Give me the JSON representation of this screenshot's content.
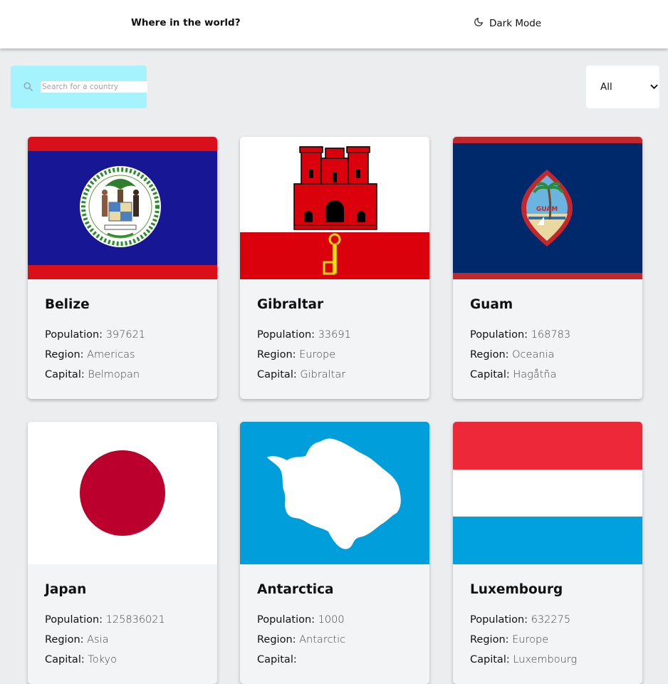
{
  "header": {
    "title": "Where in the world?",
    "dark_mode_label": "Dark Mode"
  },
  "search": {
    "placeholder": "Search for a country",
    "value": ""
  },
  "filter": {
    "selected": "All"
  },
  "labels": {
    "population": "Population:",
    "region": "Region:",
    "capital": "Capital:"
  },
  "countries": [
    {
      "name": "Belize",
      "population": "397621",
      "region": "Americas",
      "capital": "Belmopan",
      "flag": "belize-flag"
    },
    {
      "name": "Gibraltar",
      "population": "33691",
      "region": "Europe",
      "capital": "Gibraltar",
      "flag": "gibraltar-flag"
    },
    {
      "name": "Guam",
      "population": "168783",
      "region": "Oceania",
      "capital": "Hagåtña",
      "flag": "guam-flag"
    },
    {
      "name": "Japan",
      "population": "125836021",
      "region": "Asia",
      "capital": "Tokyo",
      "flag": "japan-flag"
    },
    {
      "name": "Antarctica",
      "population": "1000",
      "region": "Antarctic",
      "capital": "",
      "flag": "antarctica-flag"
    },
    {
      "name": "Luxembourg",
      "population": "632275",
      "region": "Europe",
      "capital": "Luxembourg",
      "flag": "luxembourg-flag"
    }
  ],
  "colors": {
    "header_bg": "#ffffff",
    "page_bg": "#ecedef",
    "search_bg": "#a5f3fc",
    "card_bg": "#f3f4f6"
  }
}
